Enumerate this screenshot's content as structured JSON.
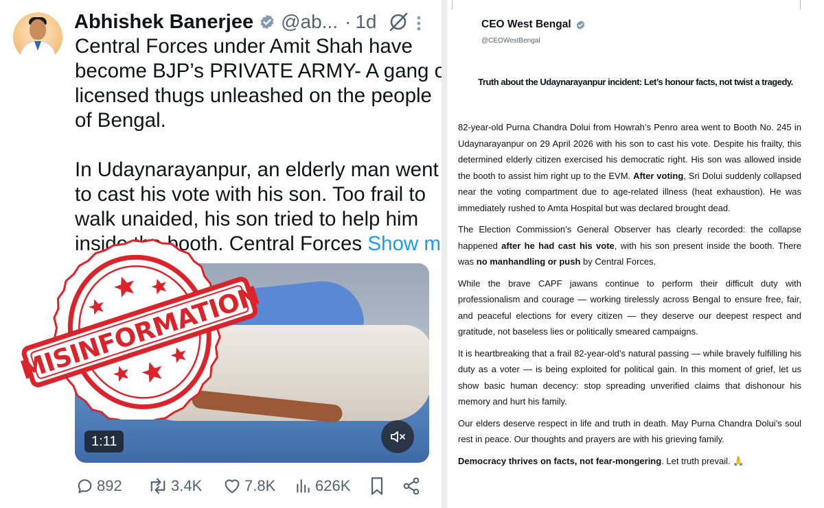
{
  "post": {
    "author_name": "Abhishek Banerjee",
    "author_handle": "@ab...",
    "dot": "·",
    "age": "1d",
    "lines": [
      "Central Forces under Amit Shah have",
      "become BJP’s PRIVATE ARMY- A gang of",
      "licensed thugs unleashed on the people",
      "of Bengal.",
      "In Udaynarayanpur, an elderly man went",
      "to cast his vote with his son. Too frail to",
      "walk unaided, his son tried to help him",
      "inside the booth. Central Forces"
    ],
    "show_more": "Show more",
    "video_duration": "1:11",
    "stamp_text": "MISINFORMATION",
    "stats": {
      "replies": "892",
      "reposts": "3.4K",
      "likes": "7.8K",
      "views": "626K"
    },
    "colors": {
      "link": "#1d9bf0",
      "verified": "#829aab",
      "stamp": "#d9242b",
      "muted": "#536471"
    }
  },
  "document": {
    "name": "CEO West Bengal",
    "handle": "@CEOWestBengal",
    "heading": "Truth about the Udaynarayanpur incident: Let’s honour facts, not twist a tragedy.",
    "p1": "82-year-old Purna Chandra Dolui from Howrah’s Penro area went to Booth No. 245 in Udaynarayanpur on 29 April 2026 with his son to cast his vote. Despite his frailty, this determined elderly citizen exercised his democratic right. His son was allowed inside the booth to assist him right up to the EVM.",
    "p1_bold": "After voting",
    "p1_rest": ", Sri Dolui suddenly collapsed near the voting compartment due to age-related illness (heat exhaustion). He was immediately rushed to Amta Hospital but was declared brought dead.",
    "p2_a": "The Election Commission’s General Observer has clearly recorded: the collapse happened",
    "p2_b": "after he had cast his vote",
    "p2_c": ", with his son present inside the booth. There was",
    "p2_d": "no manhandling or push",
    "p2_e": "by Central Forces.",
    "p3": "While the brave CAPF jawans continue to perform their difficult duty with professionalism and courage — working tirelessly across Bengal to ensure free, fair, and peaceful elections for every citizen — they deserve our deepest respect and gratitude, not baseless lies or politically smeared campaigns.",
    "p4": "It is heartbreaking that a frail 82-year-old’s natural passing — while bravely fulfilling his duty as a voter — is being exploited for political gain. In this moment of grief, let us show basic human decency: stop spreading unverified claims that dishonour his memory and hurt his family.",
    "p5": "Our elders deserve respect in life and truth in death. May Purna Chandra Dolui’s soul rest in peace. Our thoughts and prayers are with his grieving family.",
    "p6_bold": "Democracy thrives on facts, not fear-mongering",
    "p6_rest": ". Let truth prevail. 🙏"
  }
}
